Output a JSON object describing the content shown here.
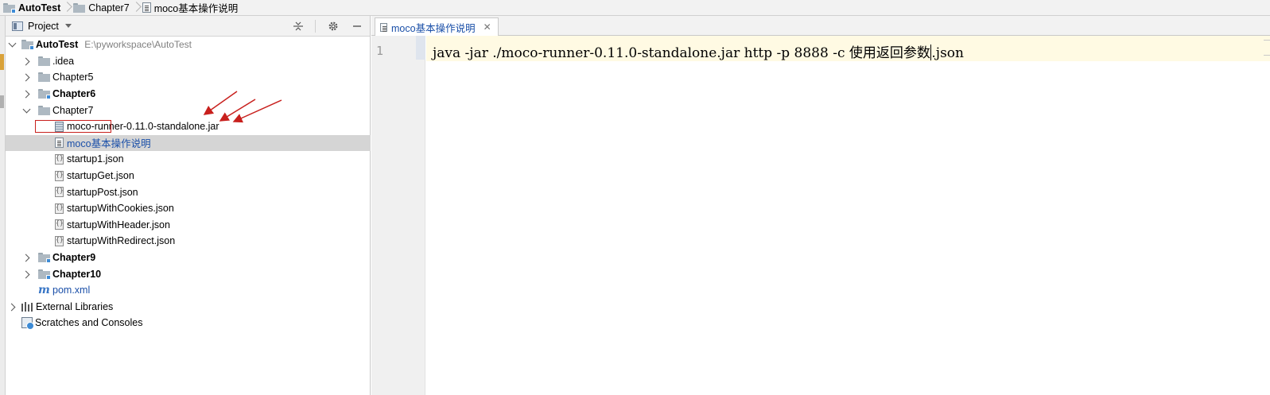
{
  "breadcrumb": {
    "items": [
      {
        "label": "AutoTest",
        "icon": "module-folder-icon"
      },
      {
        "label": "Chapter7",
        "icon": "folder-icon"
      },
      {
        "label": "moco基本操作说明",
        "icon": "text-file-icon"
      }
    ]
  },
  "project_panel": {
    "title": "Project",
    "root": {
      "label": "AutoTest",
      "path": "E:\\pyworkspace\\AutoTest"
    },
    "items": {
      "idea": ".idea",
      "chapter5": "Chapter5",
      "chapter6": "Chapter6",
      "chapter7": "Chapter7",
      "jar": "moco-runner-0.11.0-standalone.jar",
      "moco_doc": "moco基本操作说明",
      "startup1": "startup1.json",
      "startupGet": "startupGet.json",
      "startupPost": "startupPost.json",
      "startupWithCookies": "startupWithCookies.json",
      "startupWithHeader": "startupWithHeader.json",
      "startupWithRedirect": "startupWithRedirect.json",
      "chapter9": "Chapter9",
      "chapter10": "Chapter10",
      "pom": "pom.xml",
      "external_libraries": "External Libraries",
      "scratches": "Scratches and Consoles"
    },
    "colors": {
      "selection": "#d5d5d5",
      "annotation_red": "#c8201d",
      "link_blue": "#1a4fa8"
    }
  },
  "editor": {
    "tab_label": "moco基本操作说明",
    "line_number": "1",
    "code_before_caret": "java -jar ./moco-runner-0.11.0-standalone.jar http -p 8888 -c 使用返回参数",
    "code_after_caret": ".json",
    "current_line_color": "#fffae3"
  }
}
